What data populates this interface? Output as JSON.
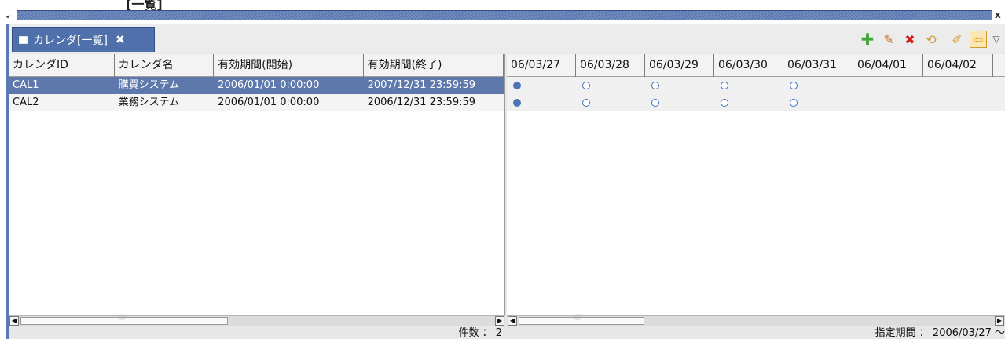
{
  "title": "[一覧]",
  "tab": {
    "label": "カレンダ[一覧]"
  },
  "calendar_table": {
    "headers": [
      "カレンダID",
      "カレンダ名",
      "有効期間(開始)",
      "有効期間(終了)"
    ],
    "rows": [
      [
        "CAL1",
        "購買システム",
        "2006/01/01 0:00:00",
        "2007/12/31 23:59:59"
      ],
      [
        "CAL2",
        "業務システム",
        "2006/01/01 0:00:00",
        "2006/12/31 23:59:59"
      ]
    ]
  },
  "schedule_table": {
    "dates": [
      "06/03/27",
      "06/03/28",
      "06/03/29",
      "06/03/30",
      "06/03/31",
      "06/04/01",
      "06/04/02"
    ],
    "rows": [
      [
        "filled",
        "open",
        "open",
        "open",
        "open",
        "",
        ""
      ],
      [
        "filled",
        "open",
        "open",
        "open",
        "open",
        "",
        ""
      ]
    ]
  },
  "status": {
    "count_text": "件数 ： 2",
    "period_text": "指定期間 ： 2006/03/27 ～"
  },
  "colors": {
    "accent": "#5b79b3",
    "selection": "#5e78ac"
  }
}
